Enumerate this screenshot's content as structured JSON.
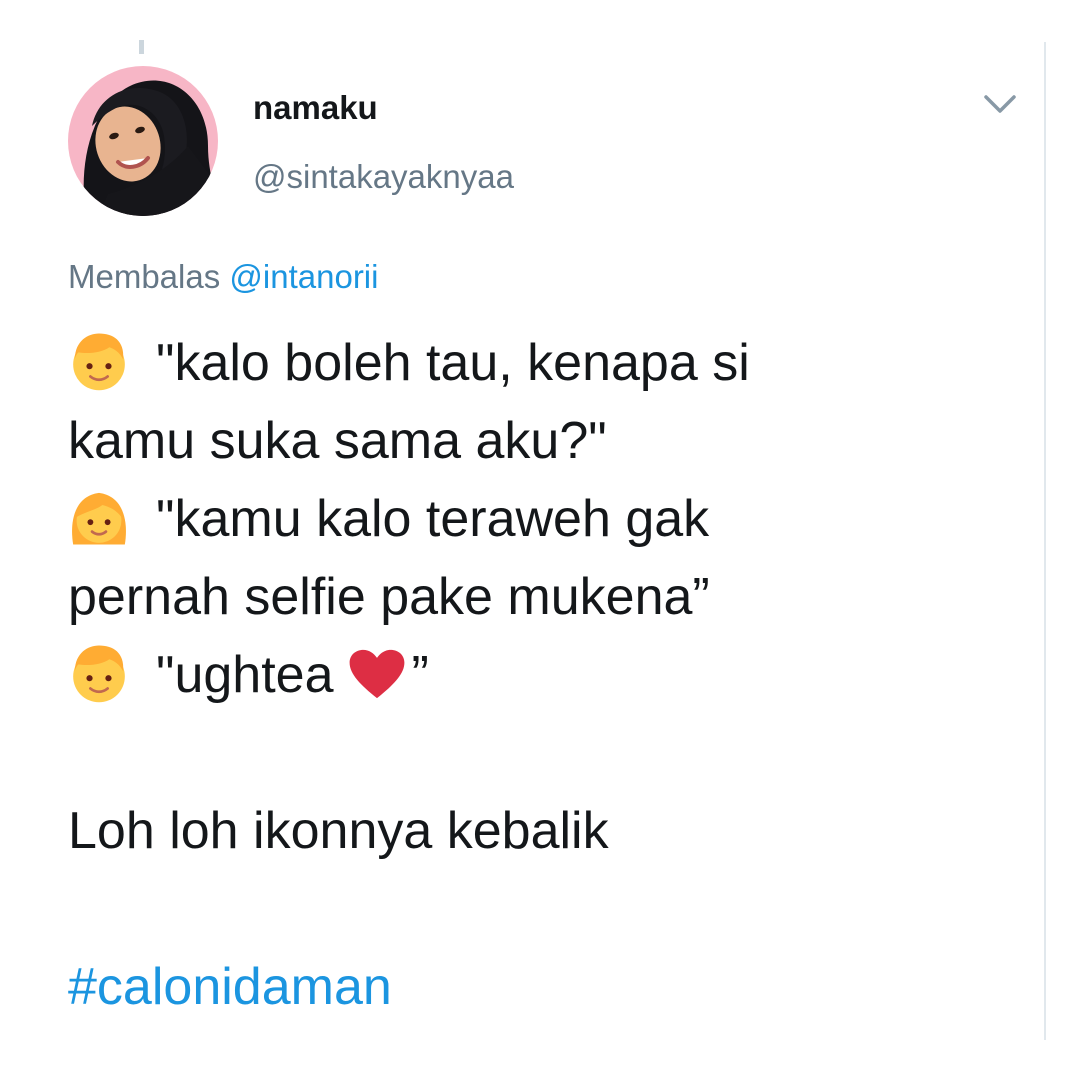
{
  "tweet": {
    "author": {
      "display_name": "namaku",
      "handle": "@sintakayaknyaa"
    },
    "reply_context": {
      "prefix": "Membalas",
      "handle": "@intanorii"
    },
    "lines": {
      "l1": "\"kalo boleh tau, kenapa si",
      "l2": "kamu suka sama aku?\"",
      "l3": "\"kamu kalo teraweh gak",
      "l4": "pernah selfie pake mukena”",
      "l5a": "\"ughtea",
      "l5b": "”",
      "l6": "Loh loh ikonnya kebalik",
      "hashtag": "#calonidaman"
    },
    "emojis": {
      "line1": "boy-emoji-icon",
      "line3": "girl-emoji-icon",
      "line5": "boy-emoji-icon",
      "heart": "red-heart-icon"
    },
    "menu_icon": "chevron-down-icon"
  },
  "colors": {
    "text": "#14171a",
    "secondary": "#657786",
    "link": "#1b95e0",
    "avatar_bg": "#f7b6c6",
    "emoji_face": "#ffcc4d",
    "boy_hair": "#ffac33",
    "girl_hair": "#ffac33",
    "heart": "#dd2e44"
  }
}
